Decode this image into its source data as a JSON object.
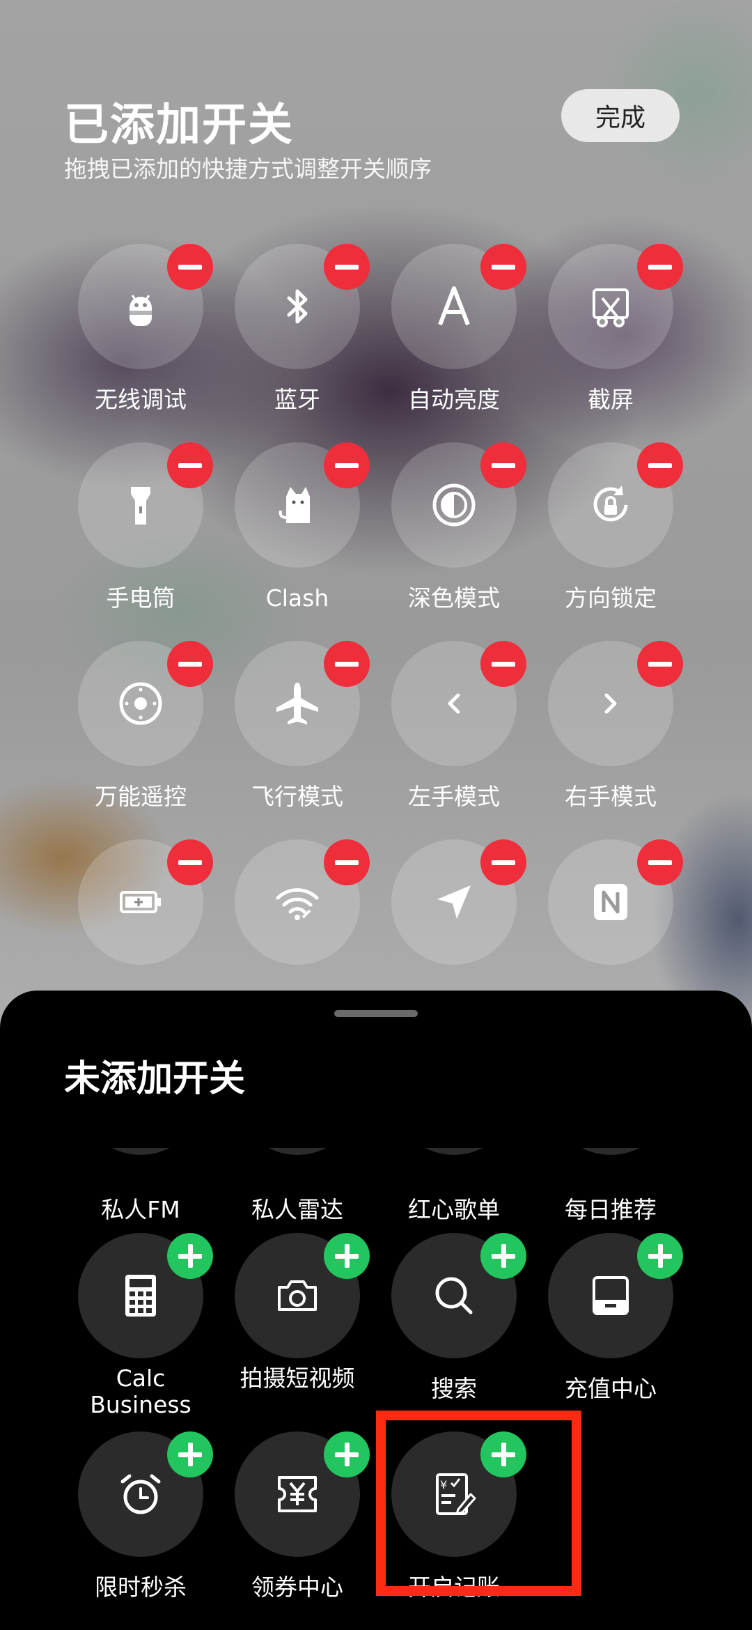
{
  "header": {
    "title": "已添加开关",
    "subtitle": "拖拽已添加的快捷方式调整开关顺序",
    "done_label": "完成"
  },
  "added_tiles": [
    {
      "label": "无线调试",
      "icon": "android-bug-icon"
    },
    {
      "label": "蓝牙",
      "icon": "bluetooth-icon"
    },
    {
      "label": "自动亮度",
      "icon": "letter-a-icon"
    },
    {
      "label": "截屏",
      "icon": "screenshot-scissors-icon"
    },
    {
      "label": "手电筒",
      "icon": "flashlight-icon"
    },
    {
      "label": "Clash",
      "icon": "cat-icon"
    },
    {
      "label": "深色模式",
      "icon": "dark-mode-icon"
    },
    {
      "label": "方向锁定",
      "icon": "rotation-lock-icon"
    },
    {
      "label": "万能遥控",
      "icon": "remote-control-icon"
    },
    {
      "label": "飞行模式",
      "icon": "airplane-icon"
    },
    {
      "label": "左手模式",
      "icon": "chevron-left-icon"
    },
    {
      "label": "右手模式",
      "icon": "chevron-right-icon"
    },
    {
      "label": "",
      "icon": "battery-saver-icon"
    },
    {
      "label": "",
      "icon": "hotspot-icon"
    },
    {
      "label": "",
      "icon": "location-arrow-icon"
    },
    {
      "label": "",
      "icon": "nfc-icon"
    }
  ],
  "sheet": {
    "title": "未添加开关",
    "partial_labels": [
      "私人FM",
      "私人雷达",
      "红心歌单",
      "每日推荐"
    ],
    "tiles": [
      {
        "label": "Calc\nBusiness",
        "icon": "calculator-icon"
      },
      {
        "label": "拍摄短视频",
        "icon": "camera-icon"
      },
      {
        "label": "搜索",
        "icon": "search-icon"
      },
      {
        "label": "充值中心",
        "icon": "tablet-wallet-icon"
      },
      {
        "label": "限时秒杀",
        "icon": "alarm-clock-icon"
      },
      {
        "label": "领券中心",
        "icon": "coupon-yen-icon"
      },
      {
        "label": "开启记账",
        "icon": "ledger-edit-icon"
      }
    ]
  },
  "colors": {
    "remove_badge": "#ee2e3b",
    "add_badge": "#22c55e",
    "highlight": "#ff2a12"
  }
}
